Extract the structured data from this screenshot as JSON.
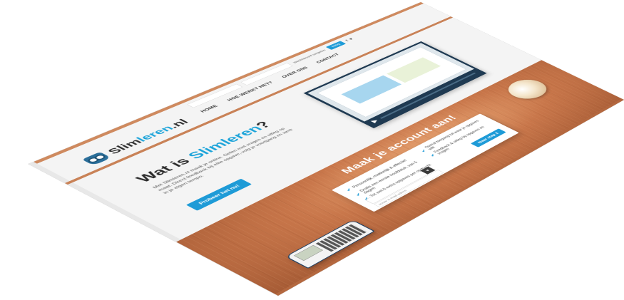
{
  "site": {
    "brand_prefix": "Slim",
    "brand_accent": "leren",
    "brand_suffix": ".nl"
  },
  "header": {
    "nav": [
      "HOME",
      "HOE WERKT HET?",
      "OVER ONS",
      "CONTACT"
    ],
    "login_button": "Inlog",
    "forgot_link": "Wachtwoord vergeten",
    "social": [
      "f",
      "♥"
    ]
  },
  "intro": {
    "title_prefix": "Wat is ",
    "title_accent": "Slimleren",
    "title_suffix": "?",
    "paragraph": "Met Slimleren.nl maak je online. Oefen met vragen en uitleg op maat. Direct feedback bij elke opgave, volg je voortgang en werk in je eigen tempo.",
    "cta": "Probeer het nu!"
  },
  "signup": {
    "title": "Maak je account aan!",
    "features": [
      "Persoonlijk, makkelijk & effectief",
      "Overal toegang tot waar je opgaves wilt",
      "Gratis een eerste hoofdstuk, van 5 dagen",
      "Feedback & uitleg bij opgaves en vragen",
      "Tot wel 6 extra opgaves per opdracht"
    ],
    "submit": "Naar stap 2",
    "email_placeholder": "Jouw e-mail adres"
  },
  "colors": {
    "accent": "#1e9bd7",
    "wood": "#c8764a"
  }
}
